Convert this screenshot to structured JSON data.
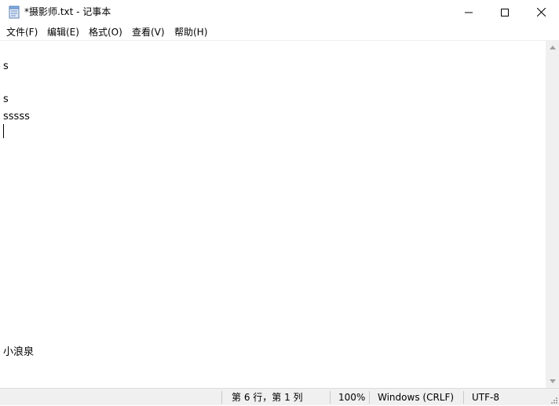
{
  "window": {
    "title": "*摄影师.txt - 记事本",
    "icon": "notepad-icon"
  },
  "menu": {
    "items": [
      {
        "label": "文件(F)"
      },
      {
        "label": "编辑(E)"
      },
      {
        "label": "格式(O)"
      },
      {
        "label": "查看(V)"
      },
      {
        "label": "帮助(H)"
      }
    ]
  },
  "editor": {
    "lines": [
      "",
      "s",
      "",
      "s",
      "sssss",
      "",
      "小浪泉"
    ]
  },
  "status": {
    "position": "第 6 行，第 1 列",
    "zoom": "100%",
    "line_ending": "Windows (CRLF)",
    "encoding": "UTF-8"
  },
  "colors": {
    "chrome": "#f0f0f0",
    "text": "#000000"
  }
}
